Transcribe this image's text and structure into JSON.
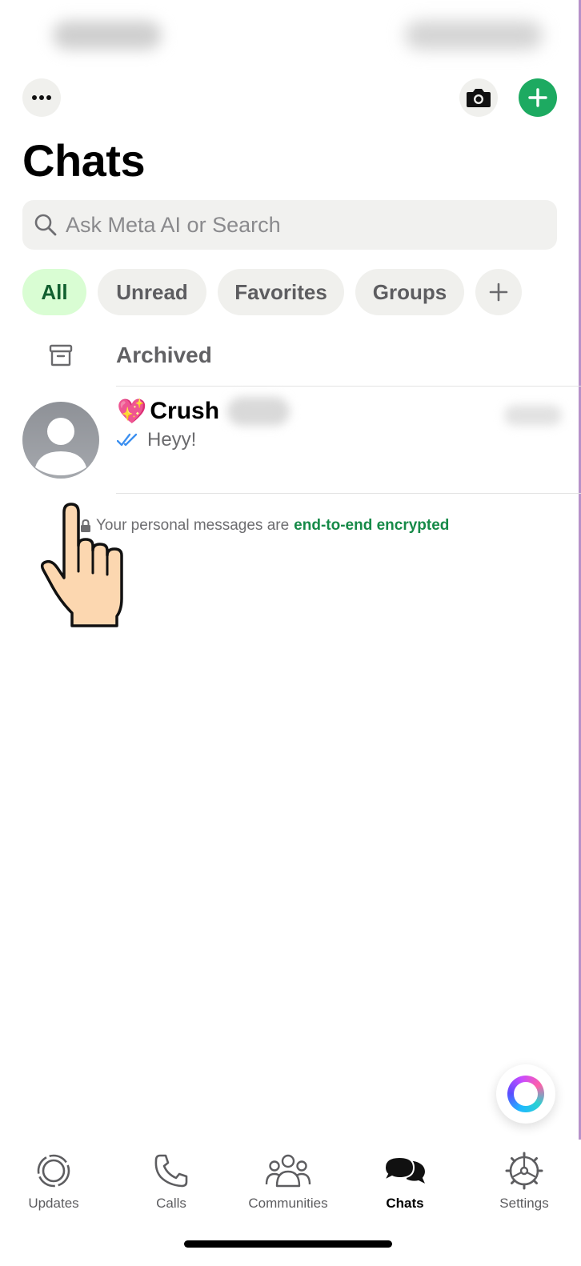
{
  "header": {
    "title": "Chats",
    "more_icon": "ellipsis-icon",
    "camera_icon": "camera-icon",
    "new_chat_icon": "plus-icon"
  },
  "search": {
    "placeholder": "Ask Meta AI or Search"
  },
  "filters": [
    {
      "label": "All",
      "active": true
    },
    {
      "label": "Unread",
      "active": false
    },
    {
      "label": "Favorites",
      "active": false
    },
    {
      "label": "Groups",
      "active": false
    }
  ],
  "archived": {
    "label": "Archived"
  },
  "chats": [
    {
      "name": "Crush",
      "emoji": "💖",
      "preview": "Heyy!",
      "read_status": "read"
    }
  ],
  "encryption_note": {
    "text": "Your personal messages are",
    "link": "end-to-end encrypted"
  },
  "tabs": [
    {
      "label": "Updates",
      "icon": "updates-icon",
      "active": false
    },
    {
      "label": "Calls",
      "icon": "phone-icon",
      "active": false
    },
    {
      "label": "Communities",
      "icon": "communities-icon",
      "active": false
    },
    {
      "label": "Chats",
      "icon": "chats-icon",
      "active": true
    },
    {
      "label": "Settings",
      "icon": "settings-icon",
      "active": false
    }
  ],
  "colors": {
    "accent_green": "#1daa61",
    "active_chip_bg": "#d9fdd3",
    "active_chip_text": "#11602f",
    "link_green": "#168a48",
    "read_tick_blue": "#3b8ff0"
  }
}
